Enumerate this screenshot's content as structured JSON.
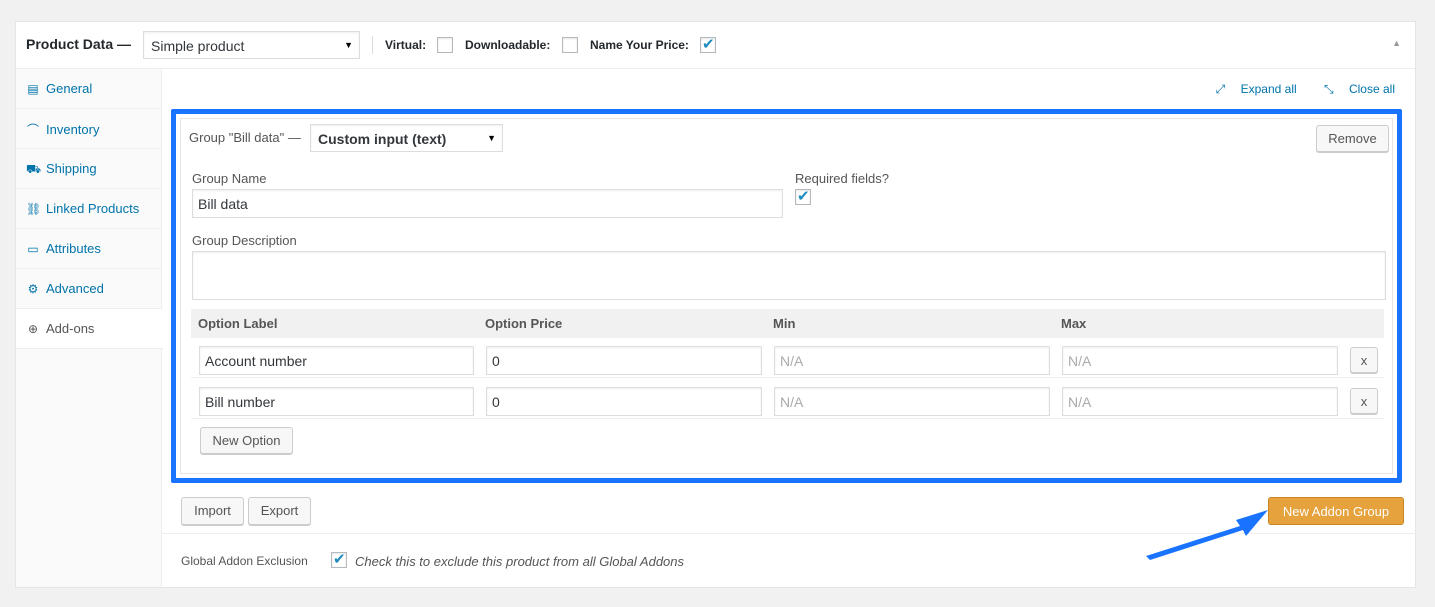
{
  "header": {
    "title": "Product Data —",
    "product_type": "Simple product",
    "virtual_label": "Virtual:",
    "virtual_checked": false,
    "downloadable_label": "Downloadable:",
    "downloadable_checked": false,
    "nyp_label": "Name Your Price:",
    "nyp_checked": true
  },
  "sidebar": {
    "items": [
      {
        "label": "General",
        "icon": "table-icon"
      },
      {
        "label": "Inventory",
        "icon": "chart-icon"
      },
      {
        "label": "Shipping",
        "icon": "truck-icon"
      },
      {
        "label": "Linked Products",
        "icon": "link-icon"
      },
      {
        "label": "Attributes",
        "icon": "list-icon"
      },
      {
        "label": "Advanced",
        "icon": "gear-icon"
      },
      {
        "label": "Add-ons",
        "icon": "plus-circle-icon"
      }
    ],
    "active": "Add-ons"
  },
  "toolbar": {
    "expand_all": "Expand all",
    "close_all": "Close all"
  },
  "group": {
    "title": "Group \"Bill data\" —",
    "type": "Custom input (text)",
    "remove_label": "Remove",
    "name_label": "Group Name",
    "name_value": "Bill data",
    "required_label": "Required fields?",
    "required_checked": true,
    "description_label": "Group Description",
    "description_value": "",
    "columns": [
      "Option Label",
      "Option Price",
      "Min",
      "Max"
    ],
    "options": [
      {
        "label": "Account number",
        "price": "0",
        "min": "N/A",
        "max": "N/A"
      },
      {
        "label": "Bill number",
        "price": "0",
        "min": "N/A",
        "max": "N/A"
      }
    ],
    "remove_option_label": "x",
    "new_option_label": "New Option"
  },
  "footer": {
    "import_label": "Import",
    "export_label": "Export",
    "new_group_label": "New Addon Group",
    "exclusion_label": "Global Addon Exclusion",
    "exclusion_checked": true,
    "exclusion_desc": "Check this to exclude this product from all Global Addons"
  },
  "colors": {
    "highlight": "#1a73ff",
    "primary_button": "#e6a23c",
    "link": "#0073aa"
  }
}
